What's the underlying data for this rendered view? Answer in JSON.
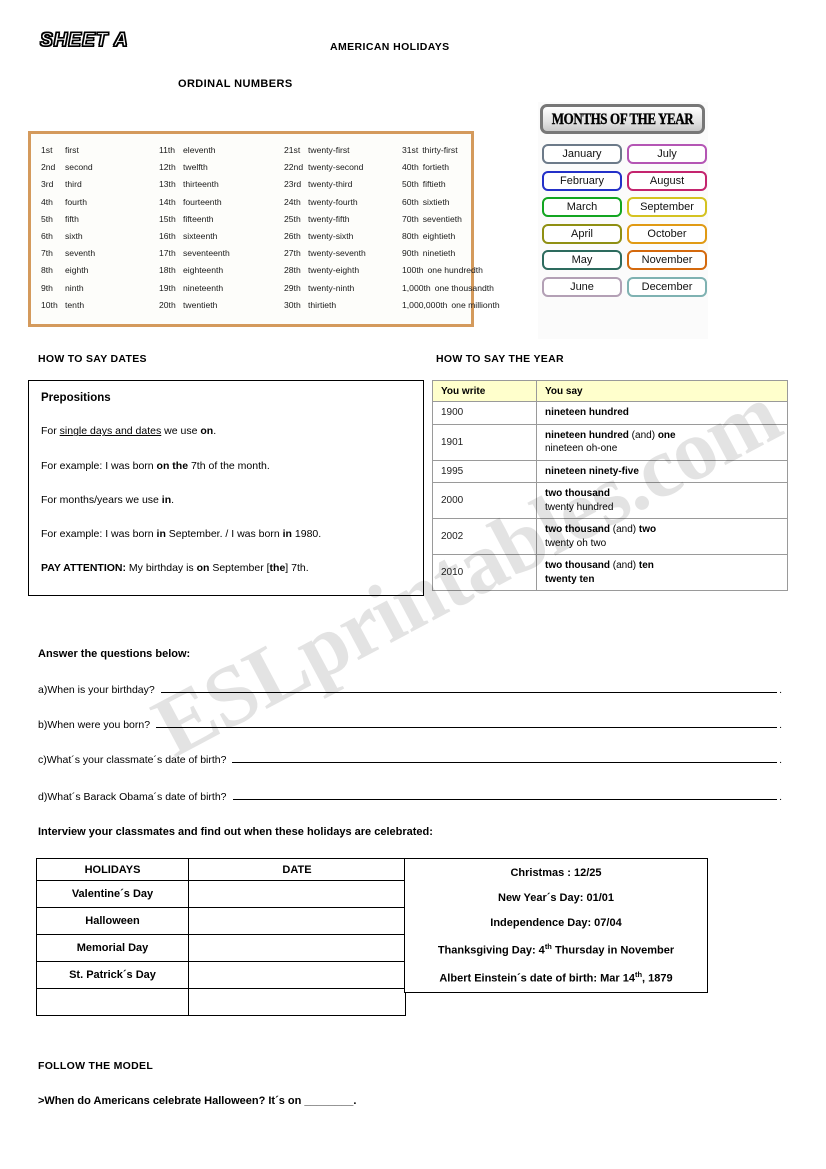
{
  "header": {
    "sheet_label": "SHEET A",
    "doc_title": "AMERICAN HOLIDAYS",
    "ordinal_section_title": "ORDINAL NUMBERS"
  },
  "ordinal_numbers": {
    "border_color": "#d49a5c",
    "columns": [
      [
        {
          "num": "1st",
          "word": "first"
        },
        {
          "num": "2nd",
          "word": "second"
        },
        {
          "num": "3rd",
          "word": "third"
        },
        {
          "num": "4th",
          "word": "fourth"
        },
        {
          "num": "5th",
          "word": "fifth"
        },
        {
          "num": "6th",
          "word": "sixth"
        },
        {
          "num": "7th",
          "word": "seventh"
        },
        {
          "num": "8th",
          "word": "eighth"
        },
        {
          "num": "9th",
          "word": "ninth"
        },
        {
          "num": "10th",
          "word": "tenth"
        }
      ],
      [
        {
          "num": "11th",
          "word": "eleventh"
        },
        {
          "num": "12th",
          "word": "twelfth"
        },
        {
          "num": "13th",
          "word": "thirteenth"
        },
        {
          "num": "14th",
          "word": "fourteenth"
        },
        {
          "num": "15th",
          "word": "fifteenth"
        },
        {
          "num": "16th",
          "word": "sixteenth"
        },
        {
          "num": "17th",
          "word": "seventeenth"
        },
        {
          "num": "18th",
          "word": "eighteenth"
        },
        {
          "num": "19th",
          "word": "nineteenth"
        },
        {
          "num": "20th",
          "word": "twentieth"
        }
      ],
      [
        {
          "num": "21st",
          "word": "twenty-first"
        },
        {
          "num": "22nd",
          "word": "twenty-second"
        },
        {
          "num": "23rd",
          "word": "twenty-third"
        },
        {
          "num": "24th",
          "word": "twenty-fourth"
        },
        {
          "num": "25th",
          "word": "twenty-fifth"
        },
        {
          "num": "26th",
          "word": "twenty-sixth"
        },
        {
          "num": "27th",
          "word": "twenty-seventh"
        },
        {
          "num": "28th",
          "word": "twenty-eighth"
        },
        {
          "num": "29th",
          "word": "twenty-ninth"
        },
        {
          "num": "30th",
          "word": "thirtieth"
        }
      ],
      [
        {
          "num": "31st",
          "word": "thirty-first"
        },
        {
          "num": "40th",
          "word": "fortieth"
        },
        {
          "num": "50th",
          "word": "fiftieth"
        },
        {
          "num": "60th",
          "word": "sixtieth"
        },
        {
          "num": "70th",
          "word": "seventieth"
        },
        {
          "num": "80th",
          "word": "eightieth"
        },
        {
          "num": "90th",
          "word": "ninetieth"
        },
        {
          "num": "100th",
          "word": "one hundredth"
        },
        {
          "num": "1,000th",
          "word": "one thousandth"
        },
        {
          "num": "1,000,000th",
          "word": "one millionth"
        }
      ]
    ]
  },
  "months_panel": {
    "banner_title": "MONTHS OF THE YEAR",
    "months": [
      {
        "name": "January",
        "color": "#6c7a89"
      },
      {
        "name": "July",
        "color": "#b455b4"
      },
      {
        "name": "February",
        "color": "#2330c8"
      },
      {
        "name": "August",
        "color": "#c4246e"
      },
      {
        "name": "March",
        "color": "#12a520"
      },
      {
        "name": "September",
        "color": "#d4c221"
      },
      {
        "name": "April",
        "color": "#8f8f12"
      },
      {
        "name": "October",
        "color": "#e09a14"
      },
      {
        "name": "May",
        "color": "#2d6b5e"
      },
      {
        "name": "November",
        "color": "#d4690d"
      },
      {
        "name": "June",
        "color": "#b3a0b5"
      },
      {
        "name": "December",
        "color": "#7fb2b2"
      }
    ]
  },
  "dates_section": {
    "heading": "HOW TO SAY DATES",
    "box_title": "Prepositions",
    "lines": {
      "l1_a": "For ",
      "l1_u": "single days and dates",
      "l1_b": " we use ",
      "l1_bold": "on",
      "l1_end": ".",
      "l2_a": "For example: I was born ",
      "l2_bold": "on the",
      "l2_end": " 7th of the month.",
      "l3_a": "For months/years we use ",
      "l3_bold": "in",
      "l3_end": ".",
      "l4_a": "For example: I was born ",
      "l4_bold1": "in",
      "l4_mid": " September. / I was born ",
      "l4_bold2": "in",
      "l4_end": " 1980.",
      "l5_bold_lead": "PAY ATTENTION:",
      "l5_a": "  My birthday is ",
      "l5_bold1": "on",
      "l5_mid": " September [",
      "l5_bold2": "the",
      "l5_end": "] 7th."
    }
  },
  "year_section": {
    "heading": "HOW TO SAY THE YEAR",
    "header_bg": "#ffffcc",
    "columns": [
      "You write",
      "You say"
    ],
    "rows": [
      {
        "write": "1900",
        "say_bold_1": "nineteen hundred",
        "say_plain_1": "",
        "say_bold_2": "",
        "say_line2_bold": "",
        "say_line2_plain": ""
      },
      {
        "write": "1901",
        "say_bold_1": "nineteen hundred",
        "say_plain_1": " (and) ",
        "say_bold_2": "one",
        "say_line2_bold": "",
        "say_line2_plain": "nineteen oh-one"
      },
      {
        "write": "1995",
        "say_bold_1": "nineteen ninety-five",
        "say_plain_1": "",
        "say_bold_2": "",
        "say_line2_bold": "",
        "say_line2_plain": ""
      },
      {
        "write": "2000",
        "say_bold_1": "two thousand",
        "say_plain_1": "",
        "say_bold_2": "",
        "say_line2_bold": "",
        "say_line2_plain": "twenty hundred"
      },
      {
        "write": "2002",
        "say_bold_1": "two thousand",
        "say_plain_1": " (and) ",
        "say_bold_2": "two",
        "say_line2_bold": "",
        "say_line2_plain": "twenty oh two"
      },
      {
        "write": "2010",
        "say_bold_1": "two thousand",
        "say_plain_1": " (and) ",
        "say_bold_2": "ten",
        "say_line2_bold": "twenty ten",
        "say_line2_plain": ""
      }
    ]
  },
  "questions_section": {
    "heading": "Answer the questions below:",
    "items": [
      {
        "text": "a)When is your birthday?",
        "end": "."
      },
      {
        "text": "b)When were you born?",
        "end": "."
      },
      {
        "text": "c)What´s your classmate´s date of birth?",
        "end": "."
      },
      {
        "text": "d)What´s Barack Obama´s date of birth?",
        "end": "."
      }
    ]
  },
  "interview_section": {
    "heading": "Interview your classmates and find out when these holidays are celebrated:",
    "table_headers": [
      "HOLIDAYS",
      "DATE"
    ],
    "rows": [
      {
        "holiday": "Valentine´s Day",
        "date": ""
      },
      {
        "holiday": "Halloween",
        "date": ""
      },
      {
        "holiday": "Memorial Day",
        "date": ""
      },
      {
        "holiday": "St. Patrick´s Day",
        "date": ""
      },
      {
        "holiday": "",
        "date": ""
      }
    ]
  },
  "reference_dates": {
    "lines": [
      {
        "pre": "Christmas : 12/25",
        "sup": "",
        "post": ""
      },
      {
        "pre": "New Year´s Day: 01/01",
        "sup": "",
        "post": ""
      },
      {
        "pre": "Independence Day: 07/04",
        "sup": "",
        "post": ""
      },
      {
        "pre": "Thanksgiving Day: 4",
        "sup": "th",
        "post": " Thursday in November"
      },
      {
        "pre": "Albert Einstein´s date of birth: Mar 14",
        "sup": "th",
        "post": ", 1879"
      }
    ]
  },
  "follow_section": {
    "heading": "FOLLOW THE MODEL",
    "model": ">When do Americans celebrate Halloween? It´s on  ________."
  },
  "watermark": {
    "text": "ESLprintables.com"
  }
}
